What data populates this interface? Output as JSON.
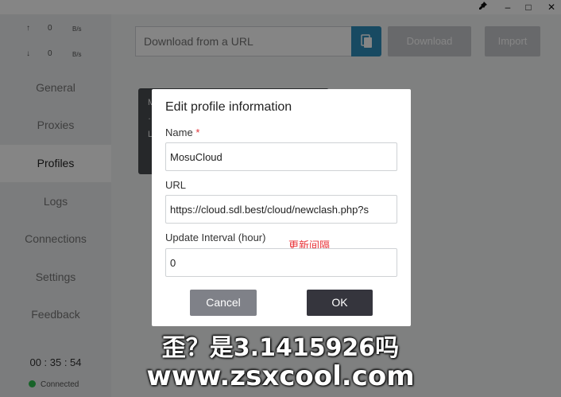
{
  "titlebar": {
    "pin_icon": "pin-icon",
    "minimize": "–",
    "maximize": "□",
    "close": "✕"
  },
  "sidebar": {
    "traffic": [
      {
        "arrow": "↑",
        "value": "0",
        "unit": "B/s"
      },
      {
        "arrow": "↓",
        "value": "0",
        "unit": "B/s"
      }
    ],
    "items": [
      {
        "label": "General"
      },
      {
        "label": "Proxies"
      },
      {
        "label": "Profiles"
      },
      {
        "label": "Logs"
      },
      {
        "label": "Connections"
      },
      {
        "label": "Settings"
      },
      {
        "label": "Feedback"
      }
    ],
    "uptime": "00 : 35 : 54",
    "status": "Connected"
  },
  "main": {
    "url_placeholder": "Download from a URL",
    "download_label": "Download",
    "import_label": "Import",
    "card_initials": [
      "M",
      "…",
      "L"
    ]
  },
  "dialog": {
    "title": "Edit profile information",
    "name_label": "Name",
    "required_mark": "*",
    "name_value": "MosuCloud",
    "url_label": "URL",
    "url_value": "https://cloud.sdl.best/cloud/newclash.php?s",
    "interval_label": "Update Interval (hour)",
    "interval_annotation": "更新间隔",
    "interval_value": "0",
    "cancel_label": "Cancel",
    "ok_label": "OK"
  },
  "watermark": {
    "line1": "歪？是3.1415926吗",
    "line2": "www.zsxcool.com"
  },
  "colors": {
    "accent": "#2f8fbd",
    "connected": "#2fbf4f",
    "required": "#e0353a"
  }
}
